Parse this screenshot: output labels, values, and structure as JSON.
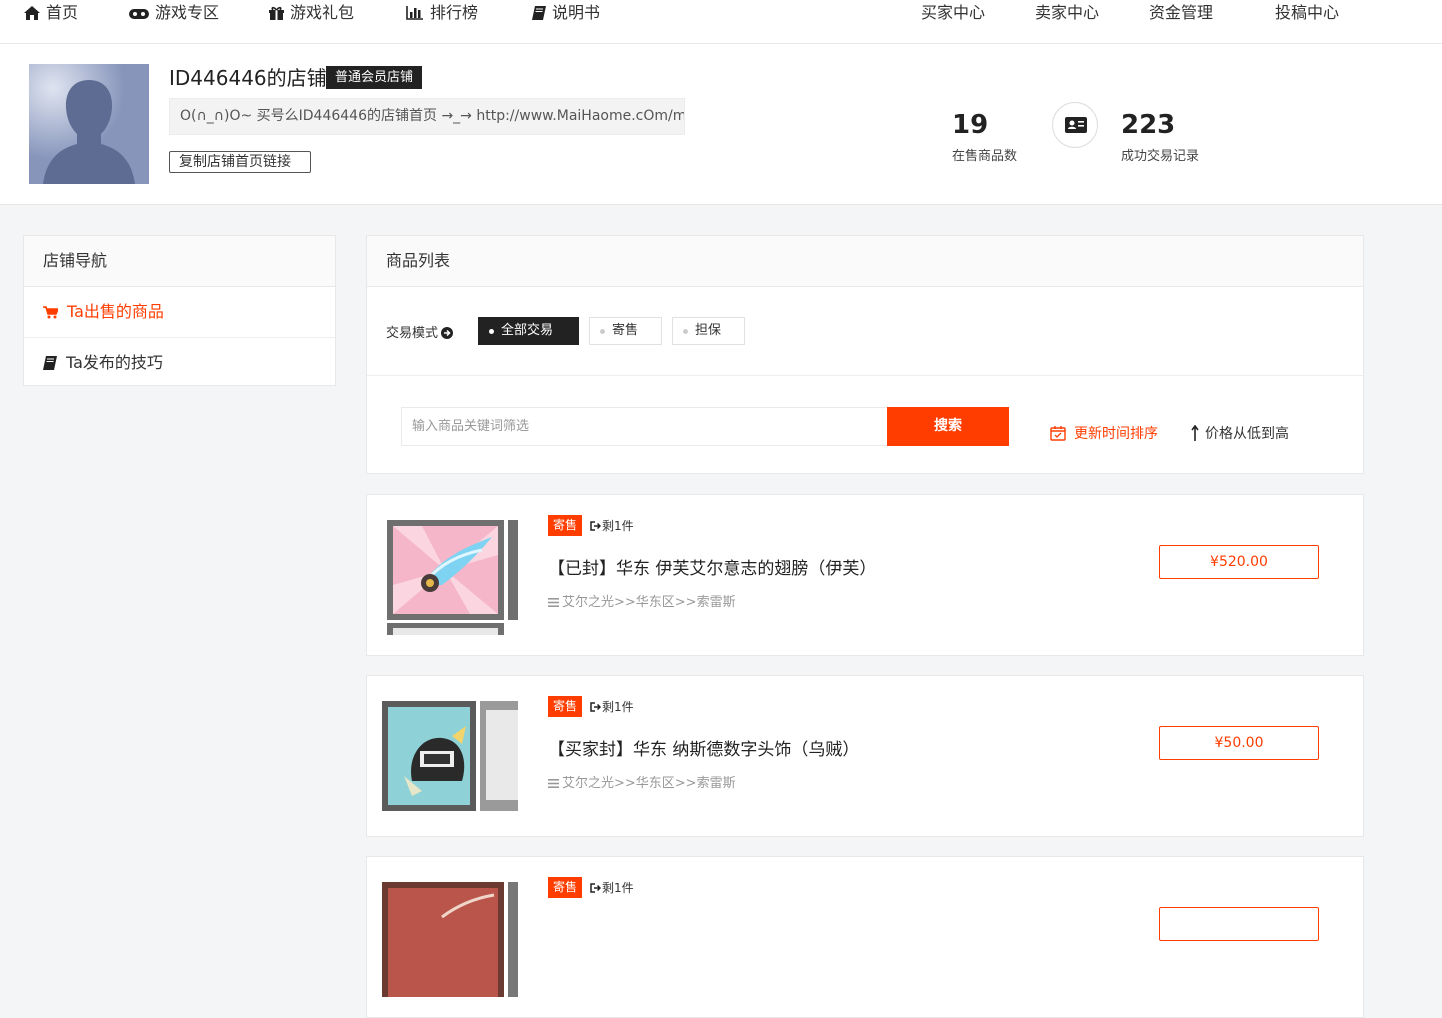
{
  "nav": {
    "left": [
      {
        "label": "首页",
        "icon": "home-icon"
      },
      {
        "label": "游戏专区",
        "icon": "gamepad-icon"
      },
      {
        "label": "游戏礼包",
        "icon": "gift-icon"
      },
      {
        "label": "排行榜",
        "icon": "bar-chart-icon"
      },
      {
        "label": "说明书",
        "icon": "book-icon"
      }
    ],
    "right": [
      "买家中心",
      "卖家中心",
      "资金管理",
      "投稿中心"
    ]
  },
  "shop": {
    "name": "ID446446的店铺",
    "badge": "普通会员店铺",
    "url_text": "O(∩_∩)O~ 买号么ID446446的店铺首页 →_→ http://www.MaiHaome.cOm/m",
    "copy_label": "复制店铺首页链接",
    "stats": [
      {
        "value": "19",
        "label": "在售商品数"
      },
      {
        "value": "223",
        "label": "成功交易记录"
      }
    ]
  },
  "sidebar": {
    "title": "店铺导航",
    "items": [
      {
        "label": "Ta出售的商品",
        "icon": "cart-icon",
        "active": true
      },
      {
        "label": "Ta发布的技巧",
        "icon": "book-icon",
        "active": false
      }
    ]
  },
  "main": {
    "title": "商品列表",
    "filter_label": "交易模式",
    "modes": [
      "全部交易",
      "寄售",
      "担保"
    ],
    "active_mode": "全部交易",
    "search_placeholder": "输入商品关键词筛选",
    "search_label": "搜索",
    "sort_time": "更新时间排序",
    "sort_price": "价格从低到高"
  },
  "products": [
    {
      "tag": "寄售",
      "remain": "剩1件",
      "title": "【已封】华东 伊芙艾尔意志的翅膀（伊芙）",
      "category": "艾尔之光>>华东区>>索雷斯",
      "price": "¥520.00"
    },
    {
      "tag": "寄售",
      "remain": "剩1件",
      "title": "【买家封】华东 纳斯德数字头饰（乌贼）",
      "category": "艾尔之光>>华东区>>索雷斯",
      "price": "¥50.00"
    },
    {
      "tag": "寄售",
      "remain": "剩1件",
      "title": "",
      "category": "",
      "price": ""
    }
  ],
  "colors": {
    "accent": "#ff3d00",
    "dark": "#222222",
    "bg": "#f4f5f7"
  }
}
